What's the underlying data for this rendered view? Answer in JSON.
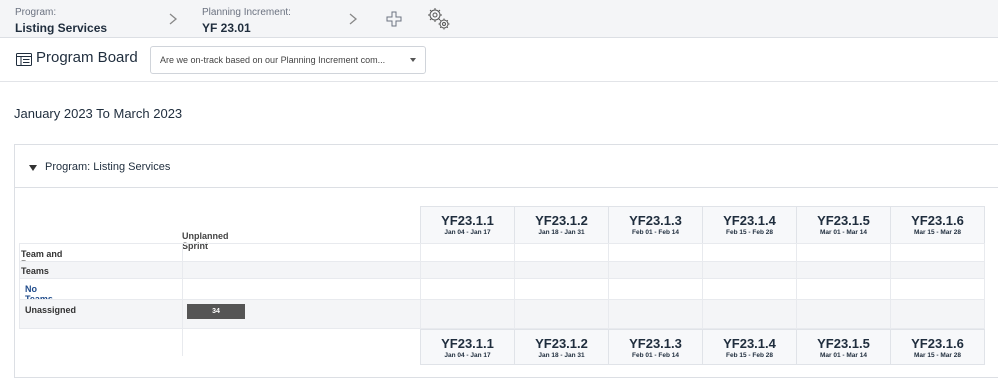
{
  "breadcrumbs": {
    "program_label": "Program:",
    "program_value": "Listing Services",
    "pi_label": "Planning Increment:",
    "pi_value": "YF 23.01"
  },
  "header": {
    "title": "Program Board",
    "question_select": "Are we on-track based on our Planning Increment com..."
  },
  "date_range": "January 2023 To March 2023",
  "panel": {
    "title": "Program: Listing Services"
  },
  "grid": {
    "unplanned_label": "Unplanned Sprint",
    "sprints": [
      {
        "name": "YF23.1.1",
        "dates": "Jan 04 - Jan 17"
      },
      {
        "name": "YF23.1.2",
        "dates": "Jan 18 - Jan 31"
      },
      {
        "name": "YF23.1.3",
        "dates": "Feb 01 - Feb 14"
      },
      {
        "name": "YF23.1.4",
        "dates": "Feb 15 - Feb 28"
      },
      {
        "name": "YF23.1.5",
        "dates": "Mar 01 - Mar 14"
      },
      {
        "name": "YF23.1.6",
        "dates": "Mar 15 - Mar 28"
      }
    ],
    "rows": {
      "objectives": "Team and Program Objectives",
      "teams": "Teams",
      "no_teams": "No Teams Assigned",
      "unassigned": "Unassigned",
      "unassigned_count": "34"
    }
  }
}
